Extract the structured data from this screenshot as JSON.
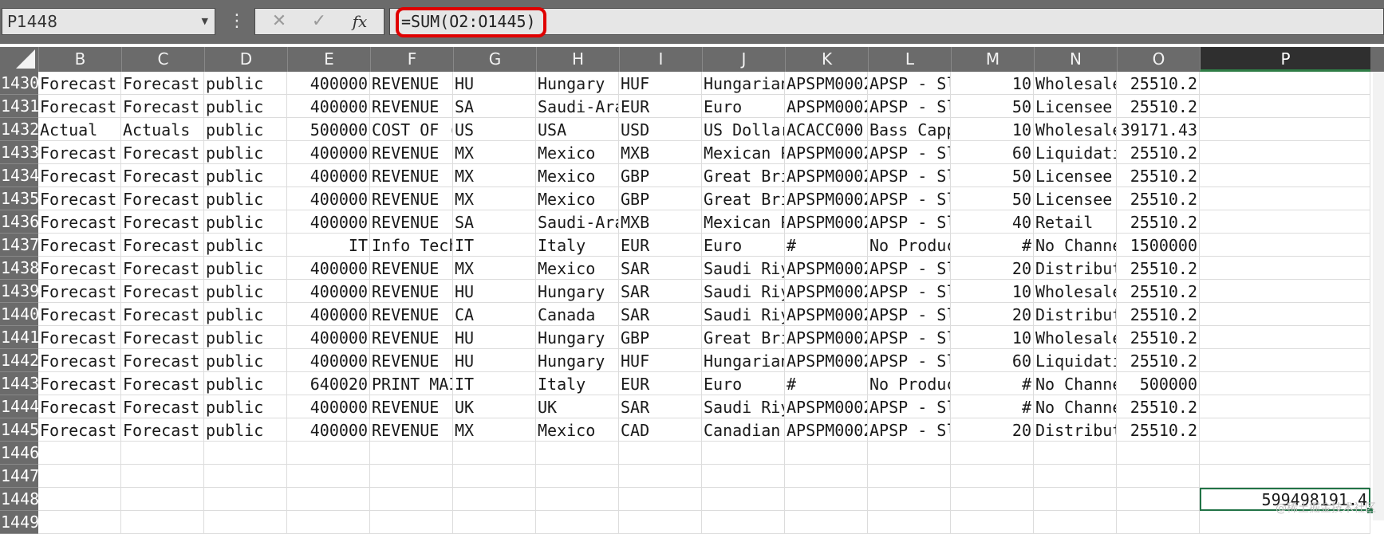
{
  "name_box": {
    "value": "P1448"
  },
  "formula_bar": {
    "cancel_icon": "✕",
    "enter_icon": "✓",
    "fx_label": "fx",
    "formula": "=SUM(O2:O1445)",
    "highlight_color": "#e00000"
  },
  "sheet": {
    "accent_color": "#217346",
    "columns": [
      "B",
      "C",
      "D",
      "E",
      "F",
      "G",
      "H",
      "I",
      "J",
      "K",
      "L",
      "M",
      "N",
      "O",
      "P"
    ],
    "selected_column": "P",
    "rows": [
      {
        "num": "1430",
        "cells": [
          "Forecast",
          "Forecast",
          "public",
          "400000",
          "REVENUE",
          "HU",
          "Hungary",
          "HUF",
          "Hungarian",
          "APSPM0002",
          "APSP - Sl",
          "10",
          "Wholesale",
          "25510.2",
          ""
        ]
      },
      {
        "num": "1431",
        "cells": [
          "Forecast",
          "Forecast",
          "public",
          "400000",
          "REVENUE",
          "SA",
          "Saudi-Ara",
          "EUR",
          "Euro",
          "APSPM0002",
          "APSP - Sl",
          "50",
          "Licensee",
          "25510.2",
          ""
        ]
      },
      {
        "num": "1432",
        "cells": [
          "Actual",
          "Actuals",
          "public",
          "500000",
          "COST OF (",
          "US",
          "USA",
          "USD",
          "US Dollar",
          "ACACC000",
          "Bass Capp",
          "10",
          "Wholesale",
          "39171.43",
          ""
        ]
      },
      {
        "num": "1433",
        "cells": [
          "Forecast",
          "Forecast",
          "public",
          "400000",
          "REVENUE",
          "MX",
          "Mexico",
          "MXB",
          "Mexican P",
          "APSPM0002",
          "APSP - Sl",
          "60",
          "Liquidati",
          "25510.2",
          ""
        ]
      },
      {
        "num": "1434",
        "cells": [
          "Forecast",
          "Forecast",
          "public",
          "400000",
          "REVENUE",
          "MX",
          "Mexico",
          "GBP",
          "Great Bri",
          "APSPM0002",
          "APSP - Sl",
          "50",
          "Licensee",
          "25510.2",
          ""
        ]
      },
      {
        "num": "1435",
        "cells": [
          "Forecast",
          "Forecast",
          "public",
          "400000",
          "REVENUE",
          "MX",
          "Mexico",
          "GBP",
          "Great Bri",
          "APSPM0002",
          "APSP - Sl",
          "50",
          "Licensee",
          "25510.2",
          ""
        ]
      },
      {
        "num": "1436",
        "cells": [
          "Forecast",
          "Forecast",
          "public",
          "400000",
          "REVENUE",
          "SA",
          "Saudi-Ara",
          "MXB",
          "Mexican P",
          "APSPM0002",
          "APSP - Sl",
          "40",
          "Retail",
          "25510.2",
          ""
        ]
      },
      {
        "num": "1437",
        "cells": [
          "Forecast",
          "Forecast",
          "public",
          "IT",
          "Info Tech",
          "IT",
          "Italy",
          "EUR",
          "Euro",
          "#",
          "No Produc",
          "#",
          "No Channe",
          "1500000",
          ""
        ]
      },
      {
        "num": "1438",
        "cells": [
          "Forecast",
          "Forecast",
          "public",
          "400000",
          "REVENUE",
          "MX",
          "Mexico",
          "SAR",
          "Saudi Riy",
          "APSPM0002",
          "APSP - Sl",
          "20",
          "Distribut",
          "25510.2",
          ""
        ]
      },
      {
        "num": "1439",
        "cells": [
          "Forecast",
          "Forecast",
          "public",
          "400000",
          "REVENUE",
          "HU",
          "Hungary",
          "SAR",
          "Saudi Riy",
          "APSPM0002",
          "APSP - Sl",
          "10",
          "Wholesale",
          "25510.2",
          ""
        ]
      },
      {
        "num": "1440",
        "cells": [
          "Forecast",
          "Forecast",
          "public",
          "400000",
          "REVENUE",
          "CA",
          "Canada",
          "SAR",
          "Saudi Riy",
          "APSPM0002",
          "APSP - Sl",
          "20",
          "Distribut",
          "25510.2",
          ""
        ]
      },
      {
        "num": "1441",
        "cells": [
          "Forecast",
          "Forecast",
          "public",
          "400000",
          "REVENUE",
          "HU",
          "Hungary",
          "GBP",
          "Great Bri",
          "APSPM0002",
          "APSP - Sl",
          "10",
          "Wholesale",
          "25510.2",
          ""
        ]
      },
      {
        "num": "1442",
        "cells": [
          "Forecast",
          "Forecast",
          "public",
          "400000",
          "REVENUE",
          "HU",
          "Hungary",
          "HUF",
          "Hungarian",
          "APSPM0002",
          "APSP - Sl",
          "60",
          "Liquidati",
          "25510.2",
          ""
        ]
      },
      {
        "num": "1443",
        "cells": [
          "Forecast",
          "Forecast",
          "public",
          "640020",
          "PRINT MAI",
          "IT",
          "Italy",
          "EUR",
          "Euro",
          "#",
          "No Produc",
          "#",
          "No Channe",
          "500000",
          ""
        ]
      },
      {
        "num": "1444",
        "cells": [
          "Forecast",
          "Forecast",
          "public",
          "400000",
          "REVENUE",
          "UK",
          "UK",
          "SAR",
          "Saudi Riy",
          "APSPM0002",
          "APSP - Sl",
          "#",
          "No Channe",
          "25510.2",
          ""
        ]
      },
      {
        "num": "1445",
        "cells": [
          "Forecast",
          "Forecast",
          "public",
          "400000",
          "REVENUE",
          "MX",
          "Mexico",
          "CAD",
          "Canadian",
          "APSPM0002",
          "APSP - Sl",
          "20",
          "Distribut",
          "25510.2",
          ""
        ]
      },
      {
        "num": "1446",
        "cells": [
          "",
          "",
          "",
          "",
          "",
          "",
          "",
          "",
          "",
          "",
          "",
          "",
          "",
          "",
          ""
        ]
      },
      {
        "num": "1447",
        "cells": [
          "",
          "",
          "",
          "",
          "",
          "",
          "",
          "",
          "",
          "",
          "",
          "",
          "",
          "",
          ""
        ]
      },
      {
        "num": "1448",
        "cells": [
          "",
          "",
          "",
          "",
          "",
          "",
          "",
          "",
          "",
          "",
          "",
          "",
          "",
          "",
          "599498191.4"
        ]
      },
      {
        "num": "1449",
        "cells": [
          "",
          "",
          "",
          "",
          "",
          "",
          "",
          "",
          "",
          "",
          "",
          "",
          "",
          "",
          ""
        ]
      }
    ]
  },
  "watermark": "@稀土掘金技术社区"
}
